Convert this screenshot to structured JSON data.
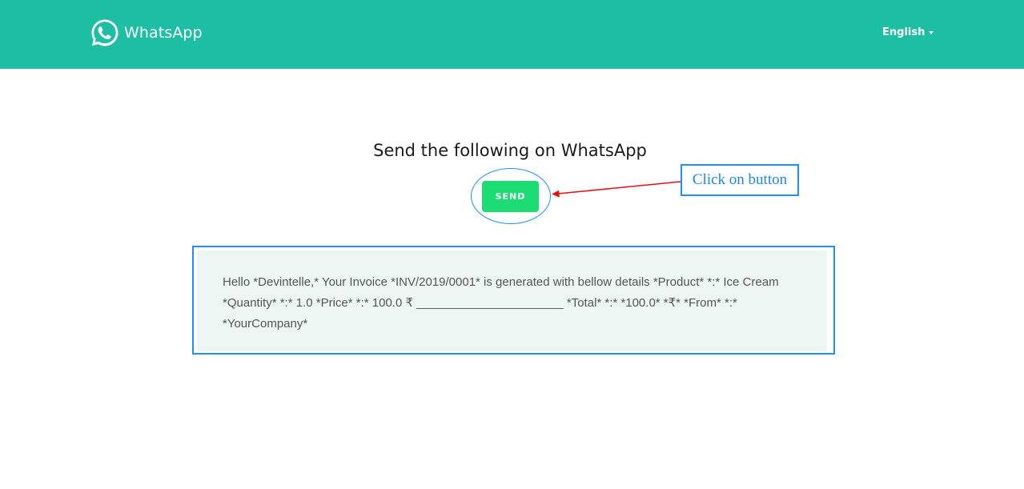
{
  "header": {
    "brand": "WhatsApp",
    "logo_icon": "whatsapp-logo-icon",
    "language": "English",
    "background_color": "#1ebea5"
  },
  "main": {
    "title": "Send the following on WhatsApp",
    "send_button_label": "SEND",
    "send_button_color": "#1ddc73",
    "message_text": "Hello *Devintelle,* Your Invoice *INV/2019/0001* is generated with bellow details *Product* *:* Ice Cream *Quantity* *:* 1.0 *Price* *:* 100.0 ₹ ______________________ *Total* *:* *100.0* *₹* *From* *:* *YourCompany*"
  },
  "annotation": {
    "callout_text": "Click on button",
    "annotation_color": "#1e90ff",
    "arrow_color": "#e81010"
  }
}
